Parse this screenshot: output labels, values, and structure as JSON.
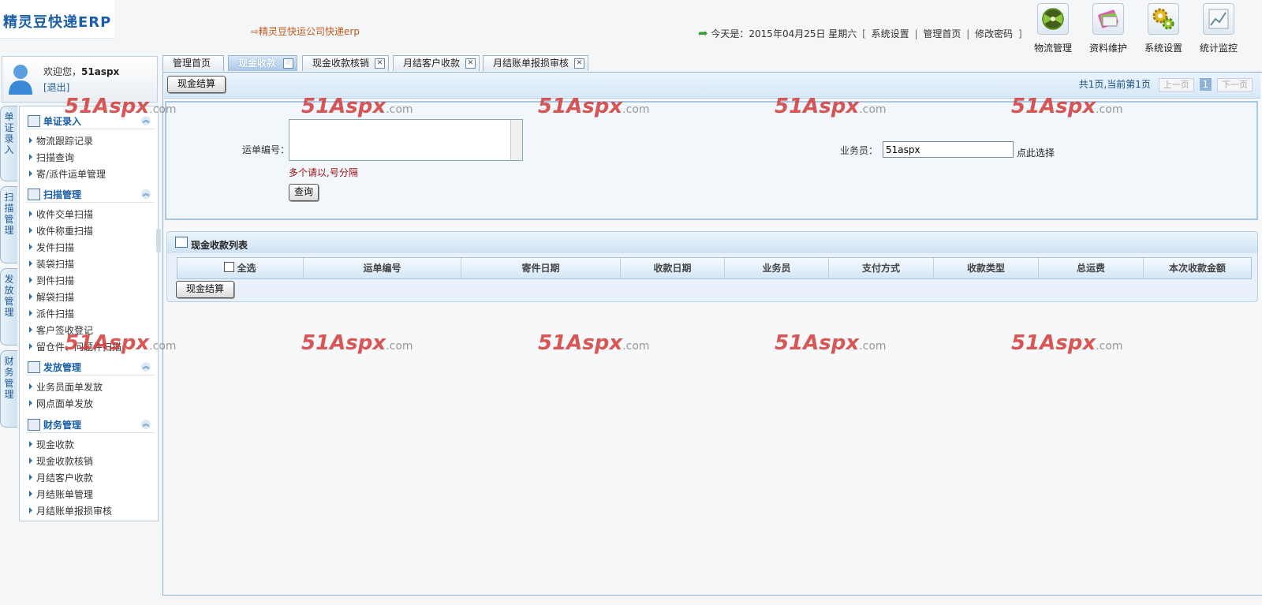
{
  "app": {
    "logo_text": "精灵豆快递ERP",
    "company_link": "⇨精灵豆快运公司快递erp"
  },
  "topbar": {
    "date_text": "今天是：2015年04月25日 星期六",
    "bracket_open": "[",
    "bracket_close": "]",
    "links": [
      "系统设置",
      "管理首页",
      "修改密码"
    ]
  },
  "top_icons": [
    {
      "label": "物流管理",
      "icon": "radiation-icon",
      "color": "#7fbf3f"
    },
    {
      "label": "资料维护",
      "icon": "books-icon",
      "color": "#d05ab0"
    },
    {
      "label": "系统设置",
      "icon": "gears-icon",
      "color": "#e0b020"
    },
    {
      "label": "统计监控",
      "icon": "chart-icon",
      "color": "#9aa8b4"
    }
  ],
  "user": {
    "welcome": "欢迎您，",
    "username": "51aspx",
    "logout": "[退出]"
  },
  "side_tabs": [
    "单证录入",
    "扫描管理",
    "发放管理",
    "财务管理"
  ],
  "menu": [
    {
      "title": "单证录入",
      "items": [
        "物流跟踪记录",
        "扫描查询",
        "寄/派件运单管理"
      ]
    },
    {
      "title": "扫描管理",
      "items": [
        "收件交单扫描",
        "收件称重扫描",
        "发件扫描",
        "装袋扫描",
        "到件扫描",
        "解袋扫描",
        "派件扫描",
        "客户签收登记",
        "留仓件、问题件扫描"
      ]
    },
    {
      "title": "发放管理",
      "items": [
        "业务员面单发放",
        "网点面单发放"
      ]
    },
    {
      "title": "财务管理",
      "items": [
        "现金收款",
        "现金收款核销",
        "月结客户收款",
        "月结账单管理",
        "月结账单报损审核"
      ]
    }
  ],
  "tabs": [
    {
      "label": "管理首页",
      "active": false,
      "closable": false
    },
    {
      "label": "现金收款",
      "active": true,
      "closable": true
    },
    {
      "label": "现金收款核销",
      "active": false,
      "closable": true
    },
    {
      "label": "月结客户收款",
      "active": false,
      "closable": true
    },
    {
      "label": "月结账单报损审核",
      "active": false,
      "closable": true
    }
  ],
  "toolbar": {
    "settle_button": "现金结算"
  },
  "pager": {
    "summary": "共1页,当前第1页",
    "prev": "上一页",
    "current": "1",
    "next": "下一页"
  },
  "search": {
    "waybill_label": "运单编号：",
    "waybill_value": "",
    "hint": "多个请以,号分隔",
    "query_button": "查询",
    "salesman_label": "业务员：",
    "salesman_value": "51aspx",
    "pick_link": "点此选择"
  },
  "list": {
    "title": "现金收款列表",
    "select_all": "全选",
    "columns": [
      "运单编号",
      "寄件日期",
      "收款日期",
      "业务员",
      "支付方式",
      "收款类型",
      "总运费",
      "本次收款金额"
    ],
    "settle_button": "现金结算"
  },
  "watermark": {
    "brand": "51Aspx",
    "suffix": ".com"
  }
}
